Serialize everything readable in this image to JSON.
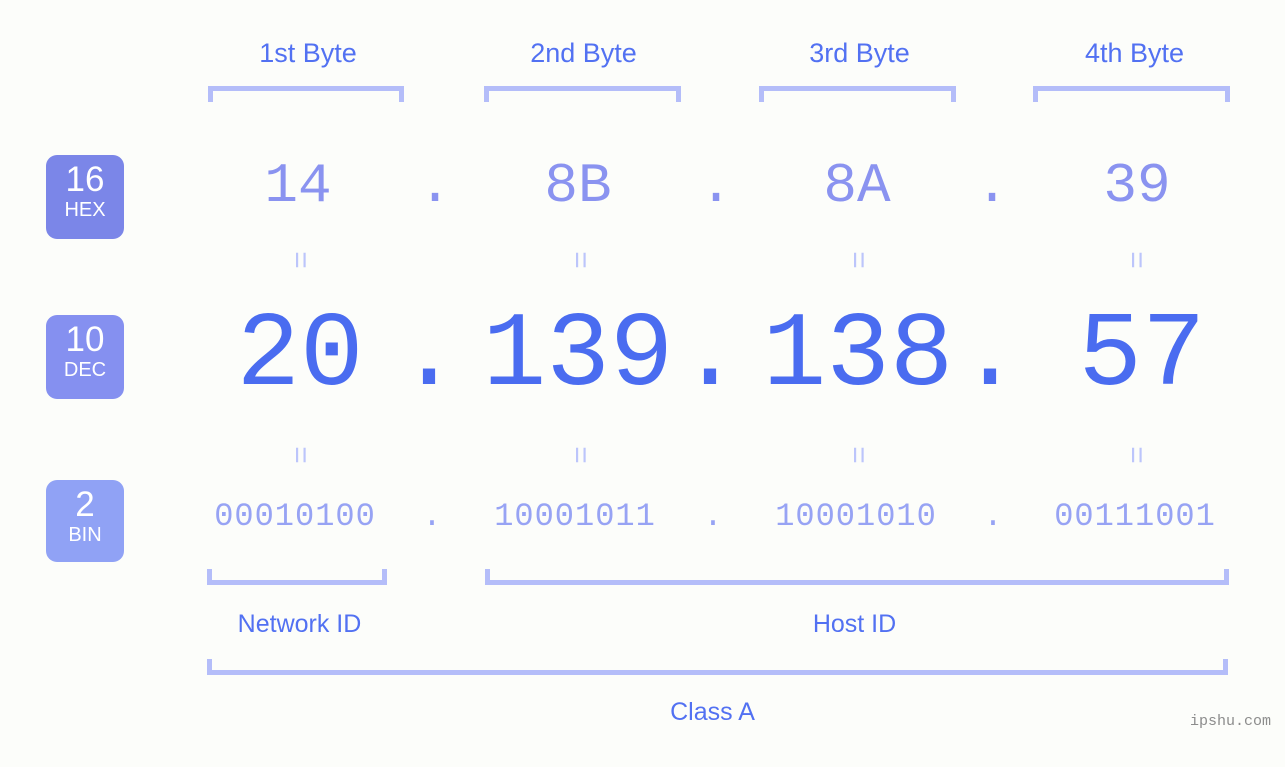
{
  "theme": {
    "background": "#fcfdfa",
    "accent_strong": "#4a6cf0",
    "accent_header": "#5271f2",
    "accent_mid": "#8a93f0",
    "accent_light": "#97a3f4",
    "bracket": "#b4bdf9",
    "badge_hex_bg": "#7b86e8",
    "badge_dec_bg": "#8590f0",
    "badge_bin_bg": "#90a2f5",
    "watermark_color": "#8c8c8c"
  },
  "byte_headers": [
    {
      "label": "1st Byte"
    },
    {
      "label": "2nd Byte"
    },
    {
      "label": "3rd Byte"
    },
    {
      "label": "4th Byte"
    }
  ],
  "bases": [
    {
      "id": "hex",
      "number": "16",
      "name": "HEX"
    },
    {
      "id": "dec",
      "number": "10",
      "name": "DEC"
    },
    {
      "id": "bin",
      "number": "2",
      "name": "BIN"
    }
  ],
  "rows": {
    "hex": {
      "octets": [
        "14",
        "8B",
        "8A",
        "39"
      ],
      "separator": "."
    },
    "dec": {
      "octets": [
        "20",
        "139",
        "138",
        "57"
      ],
      "separator": "."
    },
    "bin": {
      "octets": [
        "00010100",
        "10001011",
        "10001010",
        "00111001"
      ],
      "separator": "."
    }
  },
  "equals_symbol": "=",
  "segments": {
    "network_id": "Network ID",
    "host_id": "Host ID",
    "class": "Class A"
  },
  "watermark": "ipshu.com"
}
